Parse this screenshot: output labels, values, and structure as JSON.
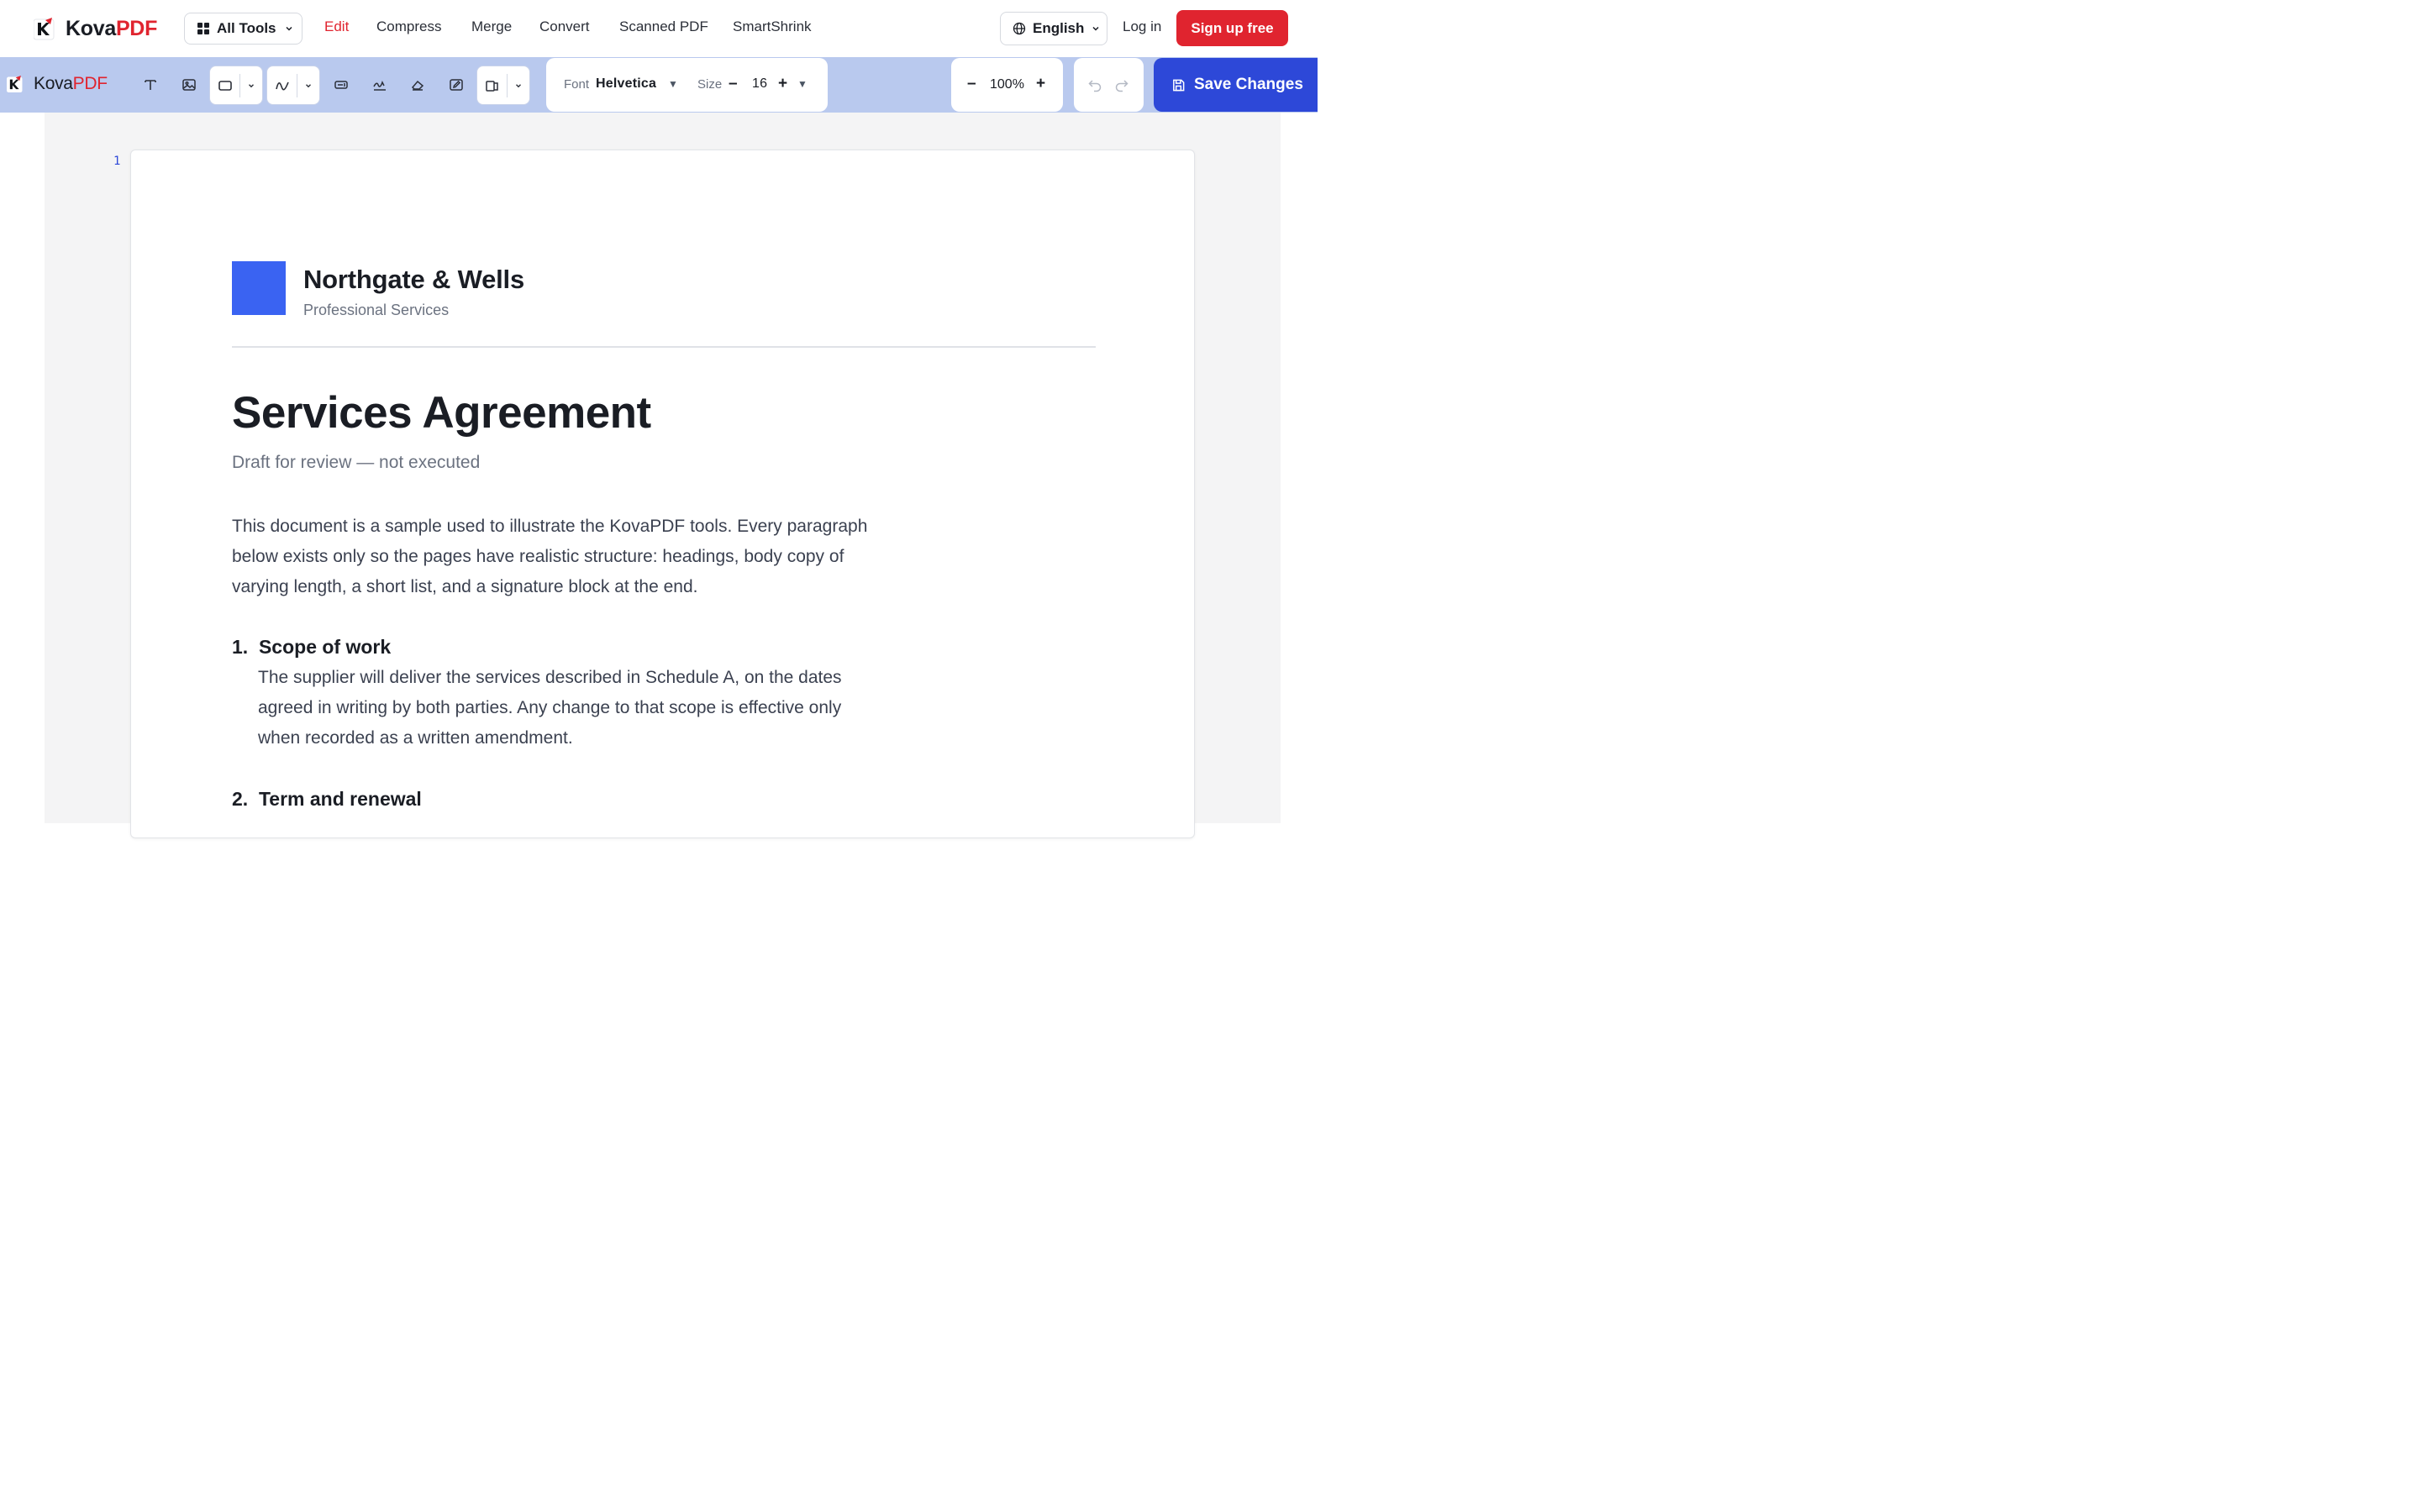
{
  "brand": {
    "name_main": "Kova",
    "name_accent": "PDF"
  },
  "nav": {
    "all_tools": "All Tools",
    "links": [
      "Edit",
      "Compress",
      "Merge",
      "Convert",
      "Scanned PDF",
      "SmartShrink"
    ],
    "active": "Edit",
    "language": "English",
    "login": "Log in",
    "signup": "Sign up free"
  },
  "toolbar": {
    "brand_main": "Kova",
    "brand_accent": "PDF",
    "tools": [
      "text-tool",
      "image-tool",
      "rectangle-tool",
      "freehand-draw-tool",
      "form-field-tool",
      "signature-tool",
      "eraser-tool",
      "edit-field-tool",
      "page-layout-tool"
    ],
    "font_label": "Font",
    "font_value": "Helvetica",
    "size_label": "Size",
    "size_value": "16",
    "size_minus": "–",
    "size_plus": "+",
    "zoom_minus": "–",
    "zoom_value": "100%",
    "zoom_plus": "+",
    "save_label": "Save Changes"
  },
  "document": {
    "page_number": "1",
    "company": "Northgate & Wells",
    "company_sub": "Professional Services",
    "title": "Services Agreement",
    "subtitle": "Draft for review — not executed",
    "intro": "This document is a sample used to illustrate the KovaPDF tools. Every paragraph below exists only so the pages have realistic structure: headings, body copy of varying length, a short list, and a signature block at the end.",
    "sections": [
      {
        "heading": "1.  Scope of work",
        "body": "The supplier will deliver the services described in Schedule A, on the dates agreed in writing by both parties. Any change to that scope is effective only when recorded as a written amendment."
      },
      {
        "heading": "2.  Term and renewal",
        "body": ""
      }
    ]
  },
  "colors": {
    "brand_red": "#e0242f",
    "toolbar_bg": "#b9c9ee",
    "save_blue": "#2d48d8",
    "logo_blue": "#3a63f2"
  }
}
